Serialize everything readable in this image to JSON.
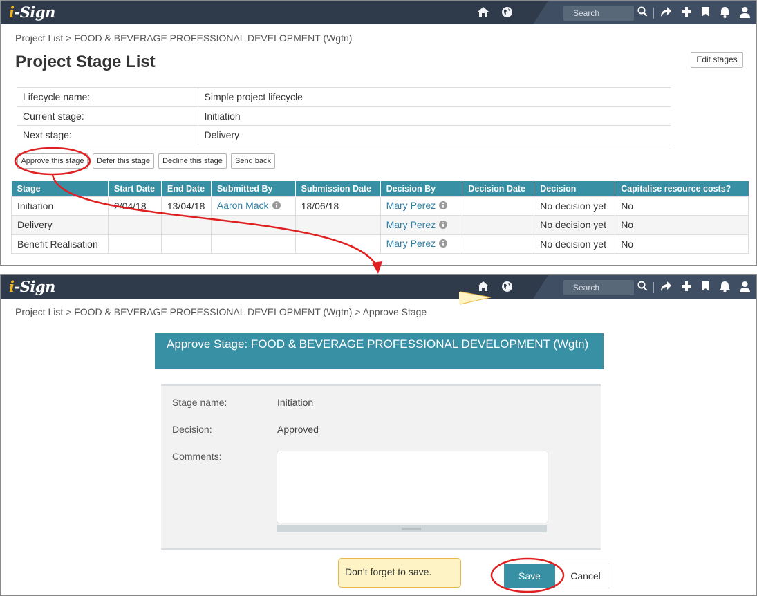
{
  "topbar": {
    "logo_text": "i-Sign",
    "search_placeholder": "Search",
    "icons": [
      "home-icon",
      "globe-icon",
      "search-icon",
      "share-icon",
      "plus-icon",
      "bookmark-icon",
      "bell-icon",
      "user-icon"
    ],
    "colors": {
      "bar": "#2f3a4a",
      "accent": "#f2b51c"
    }
  },
  "screen1": {
    "breadcrumb": "Project List > FOOD & BEVERAGE PROFESSIONAL DEVELOPMENT (Wgtn)",
    "title": "Project Stage List",
    "edit_stages_label": "Edit stages",
    "info": [
      {
        "label": "Lifecycle name:",
        "value": "Simple project lifecycle"
      },
      {
        "label": "Current stage:",
        "value": "Initiation"
      },
      {
        "label": "Next stage:",
        "value": "Delivery"
      }
    ],
    "actions": [
      "Approve this stage",
      "Defer this stage",
      "Decline this stage",
      "Send back"
    ],
    "table": {
      "headers": [
        "Stage",
        "Start Date",
        "End Date",
        "Submitted By",
        "Submission Date",
        "Decision By",
        "Decision Date",
        "Decision",
        "Capitalise resource costs?"
      ],
      "rows": [
        {
          "stage": "Initiation",
          "start": "2/04/18",
          "end": "13/04/18",
          "submitted_by": "Aaron Mack",
          "submission_date": "18/06/18",
          "decision_by": "Mary Perez",
          "decision_date": "",
          "decision": "No decision yet",
          "capitalise": "No"
        },
        {
          "stage": "Delivery",
          "start": "",
          "end": "",
          "submitted_by": "",
          "submission_date": "",
          "decision_by": "Mary Perez",
          "decision_date": "",
          "decision": "No decision yet",
          "capitalise": "No"
        },
        {
          "stage": "Benefit Realisation",
          "start": "",
          "end": "",
          "submitted_by": "",
          "submission_date": "",
          "decision_by": "Mary Perez",
          "decision_date": "",
          "decision": "No decision yet",
          "capitalise": "No"
        }
      ],
      "header_color": "#3790a4",
      "link_color": "#2e7fa6"
    }
  },
  "screen2": {
    "breadcrumb": "Project List > FOOD & BEVERAGE PROFESSIONAL DEVELOPMENT (Wgtn) > Approve Stage",
    "dialog_title": "Approve Stage: FOOD & BEVERAGE PROFESSIONAL DEVELOPMENT (Wgtn)",
    "fields": [
      {
        "label": "Stage name:",
        "value": "Initiation"
      },
      {
        "label": "Decision:",
        "value": "Approved"
      },
      {
        "label": "Comments:",
        "value": ""
      }
    ],
    "save_label": "Save",
    "cancel_label": "Cancel",
    "callout_text": "Don’t forget to save."
  },
  "annotation_color": "#e02020"
}
